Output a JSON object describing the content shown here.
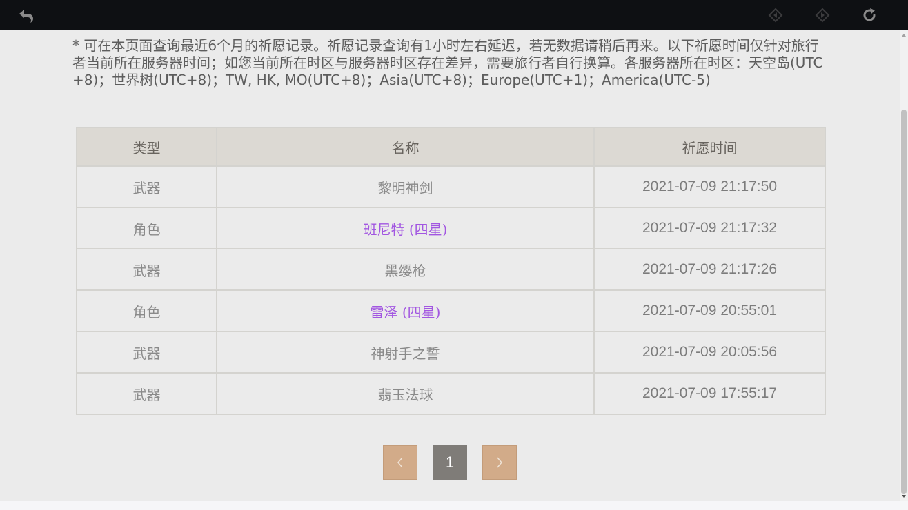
{
  "notice": "* 可在本页面查询最近6个月的祈愿记录。祈愿记录查询有1小时左右延迟，若无数据请稍后再来。以下祈愿时间仅针对旅行者当前所在服务器时间；如您当前所在时区与服务器时区存在差异，需要旅行者自行换算。各服务器所在时区：天空岛(UTC+8)；世界树(UTC+8)；TW, HK, MO(UTC+8)；Asia(UTC+8)；Europe(UTC+1)；America(UTC-5)",
  "table": {
    "headers": [
      "类型",
      "名称",
      "祈愿时间"
    ],
    "rows": [
      {
        "type": "武器",
        "name": "黎明神剑",
        "time": "2021-07-09 21:17:50",
        "highlight": false
      },
      {
        "type": "角色",
        "name": "班尼特 (四星)",
        "time": "2021-07-09 21:17:32",
        "highlight": true
      },
      {
        "type": "武器",
        "name": "黑缨枪",
        "time": "2021-07-09 21:17:26",
        "highlight": false
      },
      {
        "type": "角色",
        "name": "雷泽 (四星)",
        "time": "2021-07-09 20:55:01",
        "highlight": true
      },
      {
        "type": "武器",
        "name": "神射手之誓",
        "time": "2021-07-09 20:05:56",
        "highlight": false
      },
      {
        "type": "武器",
        "name": "翡玉法球",
        "time": "2021-07-09 17:55:17",
        "highlight": false
      }
    ]
  },
  "pagination": {
    "current_page": "1"
  },
  "colors": {
    "four_star": "#a256e1",
    "pager_button": "#d2ab89",
    "pager_current": "#7f7c78",
    "toolbar": "#0e1013"
  },
  "icons": {
    "back": "back-arrow-icon",
    "forward_left": "diamond-arrow-left-icon",
    "forward_right": "diamond-arrow-right-icon",
    "refresh": "refresh-icon",
    "prev": "chevron-left-icon",
    "next": "chevron-right-icon"
  }
}
